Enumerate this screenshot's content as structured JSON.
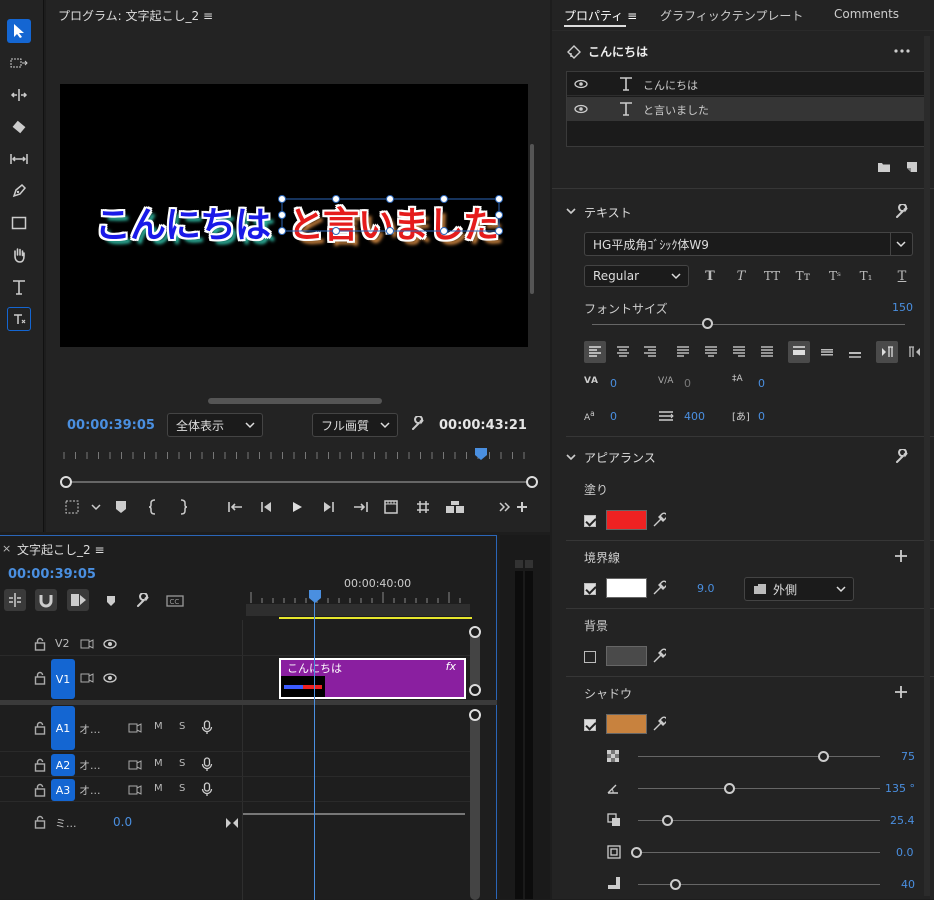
{
  "program_monitor": {
    "title": "プログラム: 文字起こし_2 ≡",
    "video_text_part1": "こんにちは",
    "video_text_part2": "と言いました",
    "timecode_current": "00:00:39:05",
    "zoom_label": "全体表示",
    "quality_label": "フル画質",
    "timecode_duration": "00:00:43:21"
  },
  "timeline": {
    "close": "×",
    "title": "文字起こし_2 ≡",
    "timecode": "00:00:39:05",
    "ruler_label": "00:00:40:00",
    "tracks": [
      {
        "id": "V2"
      },
      {
        "id": "V1"
      },
      {
        "id": "A1",
        "name": "オ..."
      },
      {
        "id": "A2",
        "name": "オ..."
      },
      {
        "id": "A3",
        "name": "オ..."
      }
    ],
    "mix_label": "ミ...",
    "mix_value": "0.0",
    "clip_label": "こんにちは",
    "clip_fx": "fx",
    "m_label": "M",
    "s_label": "S"
  },
  "properties": {
    "tabs": [
      "プロパティ ≡",
      "グラフィックテンプレート",
      "Comments"
    ],
    "layer_title": "こんにちは",
    "layers": [
      "こんにちは",
      "と言いました"
    ],
    "text_section": "テキスト",
    "font_name": "HG平成角ｺﾞｼｯｸ体W9",
    "font_style": "Regular",
    "font_size_label": "フォントサイズ",
    "font_size_value": "150",
    "font_size_fraction": 0.37,
    "kerning": "0",
    "tracking": "0",
    "leading": "0",
    "baseline": "0",
    "tab_width": "400",
    "tsume": "0",
    "appearance_section": "アピアランス",
    "fill_label": "塗り",
    "fill_color": "#ee2222",
    "stroke_label": "境界線",
    "stroke_color": "#ffffff",
    "stroke_width": "9.0",
    "stroke_type": "外側",
    "background_label": "背景",
    "background_color": "#4a4a4a",
    "shadow_label": "シャドウ",
    "shadow_color": "#c8823e",
    "shadow_opacity": "75",
    "shadow_angle": "135 °",
    "shadow_distance": "25.4",
    "shadow_size": "0.0",
    "shadow_blur": "40"
  },
  "colors": {
    "accent_blue": "#1466d2",
    "timecode_blue": "#4a8fe0",
    "clip_purple": "#8a1fa0"
  }
}
